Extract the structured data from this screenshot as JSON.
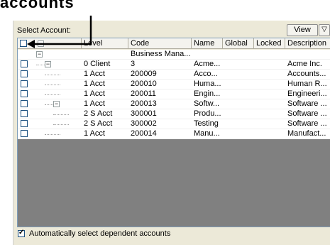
{
  "caption": "accounts",
  "select_account_label": "Select Account:",
  "view_button": "View",
  "filter_icon": "filter-funnel-icon",
  "columns": [
    {
      "label": "",
      "key": "check"
    },
    {
      "label": "Level",
      "key": "level"
    },
    {
      "label": "Code",
      "key": "code"
    },
    {
      "label": "Name",
      "key": "name"
    },
    {
      "label": "Global",
      "key": "global"
    },
    {
      "label": "Locked",
      "key": "locked"
    },
    {
      "label": "Description",
      "key": "description"
    }
  ],
  "rows": [
    {
      "checkbox": false,
      "level": "",
      "code": "Business Mana...",
      "name": "",
      "global": "",
      "locked": "",
      "description": "",
      "depth": 0,
      "expander": true
    },
    {
      "checkbox": true,
      "level": "0 Client",
      "code": "3",
      "name": "Acme...",
      "global": "",
      "locked": "",
      "description": "Acme Inc.",
      "depth": 1,
      "expander": true
    },
    {
      "checkbox": true,
      "level": "1 Acct",
      "code": "200009",
      "name": "Acco...",
      "global": "",
      "locked": "",
      "description": "Accounts...",
      "depth": 2,
      "expander": false
    },
    {
      "checkbox": true,
      "level": "1 Acct",
      "code": "200010",
      "name": "Huma...",
      "global": "",
      "locked": "",
      "description": "Human R...",
      "depth": 2,
      "expander": false
    },
    {
      "checkbox": true,
      "level": "1 Acct",
      "code": "200011",
      "name": "Engin...",
      "global": "",
      "locked": "",
      "description": "Engineeri...",
      "depth": 2,
      "expander": false
    },
    {
      "checkbox": true,
      "level": "1 Acct",
      "code": "200013",
      "name": "Softw...",
      "global": "",
      "locked": "",
      "description": "Software ...",
      "depth": 2,
      "expander": true
    },
    {
      "checkbox": true,
      "level": "2 S Acct",
      "code": "300001",
      "name": "Produ...",
      "global": "",
      "locked": "",
      "description": "Software ...",
      "depth": 3,
      "expander": false
    },
    {
      "checkbox": true,
      "level": "2 S Acct",
      "code": "300002",
      "name": "Testing",
      "global": "",
      "locked": "",
      "description": "Software ...",
      "depth": 3,
      "expander": false
    },
    {
      "checkbox": true,
      "level": "1 Acct",
      "code": "200014",
      "name": "Manu...",
      "global": "",
      "locked": "",
      "description": "Manufact...",
      "depth": 2,
      "expander": false
    }
  ],
  "auto_select_checked": true,
  "auto_select_label": "Automatically select dependent accounts"
}
